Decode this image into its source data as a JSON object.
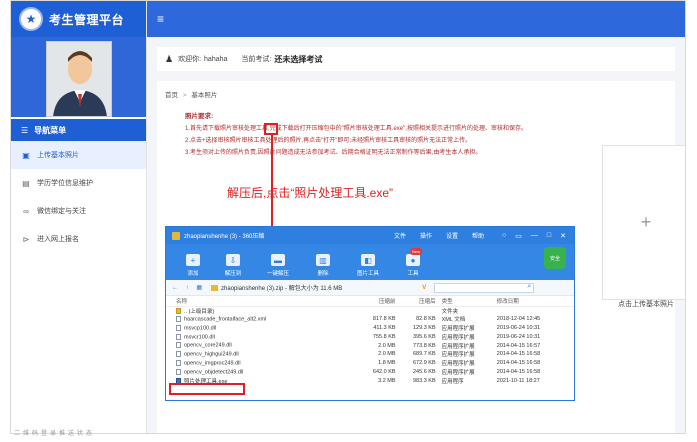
{
  "app": {
    "title": "考生管理平台",
    "menu_icon": "hamburger-icon"
  },
  "sidebar": {
    "nav_header": "导航菜单",
    "items": [
      {
        "label": "上传基本照片",
        "icon": "image-icon",
        "active": true
      },
      {
        "label": "学历学位信息维护",
        "icon": "document-icon",
        "active": false
      },
      {
        "label": "微信绑定与关注",
        "icon": "link-icon",
        "active": false
      },
      {
        "label": "进入网上报名",
        "icon": "arrow-right-icon",
        "active": false
      }
    ]
  },
  "welcome": {
    "greeting": "欢迎你:",
    "username": "hahaha",
    "exam_label": "当前考试:",
    "exam_value": "还未选择考试"
  },
  "breadcrumb": {
    "home": "首页",
    "separator": ">",
    "current": "基本照片"
  },
  "notice": {
    "title": "照片要求:",
    "lines": [
      "1.首先请下载照片审核处理工具,完成下载后打开压缩包中的\"照片审核处理工具.exe\",按照相关提示进行照片的处理、审核和保存。",
      "2.点击+选择审核照片审核工具处理后的照片,再点击\"打开\"即可;未经照片审核工具审核的照片无法正常上传。",
      "3.考生须对上传的照片负责,因照片问题造成无法参加考试、后期合格证明无法正常制作等后果,由考生本人承担。"
    ]
  },
  "annotation": "解压后,点击“照片处理工具.exe”",
  "upload": {
    "plus": "+",
    "label": "点击上传基本照片"
  },
  "zip_window": {
    "title": "zhaopianshenhe (3) - 360压缩",
    "menus": [
      "文件",
      "操作",
      "设置",
      "帮助"
    ],
    "win_buttons": [
      "○",
      "▭",
      "—",
      "□",
      "✕"
    ],
    "toolbar": [
      {
        "label": "添加",
        "icon": "plus-icon"
      },
      {
        "label": "解压到",
        "icon": "extract-icon"
      },
      {
        "label": "一键解压",
        "icon": "one-click-extract-icon"
      },
      {
        "label": "删除",
        "icon": "trash-icon"
      },
      {
        "label": "图片工具",
        "icon": "picture-icon"
      },
      {
        "label": "工具",
        "icon": "tools-icon"
      }
    ],
    "new_badge": "New",
    "safe_label": "安全",
    "address": "zhaopianshenhe (3).zip - 解包大小为 11.6 MB",
    "nav_buttons": "← ↑ ▦",
    "vmark": "V",
    "columns": [
      "名称",
      "压缩前",
      "压缩后",
      "类型",
      "修改日期"
    ],
    "rows": [
      {
        "name": ".. (上级目录)",
        "size": "",
        "comp": "",
        "type": "文件夹",
        "time": "",
        "kind": "folder"
      },
      {
        "name": "haarcascade_frontalface_alt2.xml",
        "size": "817.8 KB",
        "comp": "82.8 KB",
        "type": "XML 文档",
        "time": "2018-12-04 12:45",
        "kind": "file"
      },
      {
        "name": "msvcp100.dll",
        "size": "411.3 KB",
        "comp": "129.3 KB",
        "type": "应用程序扩展",
        "time": "2019-06-24 10:31",
        "kind": "file"
      },
      {
        "name": "msvcr100.dll",
        "size": "755.8 KB",
        "comp": "395.6 KB",
        "type": "应用程序扩展",
        "time": "2019-06-24 10:31",
        "kind": "file"
      },
      {
        "name": "opencv_core249.dll",
        "size": "2.0 MB",
        "comp": "773.8 KB",
        "type": "应用程序扩展",
        "time": "2014-04-15 16:57",
        "kind": "file"
      },
      {
        "name": "opencv_highgui249.dll",
        "size": "2.0 MB",
        "comp": "689.7 KB",
        "type": "应用程序扩展",
        "time": "2014-04-15 16:58",
        "kind": "file"
      },
      {
        "name": "opencv_imgproc249.dll",
        "size": "1.8 MB",
        "comp": "672.9 KB",
        "type": "应用程序扩展",
        "time": "2014-04-15 16:58",
        "kind": "file"
      },
      {
        "name": "opencv_objdetect249.dll",
        "size": "642.0 KB",
        "comp": "245.6 KB",
        "type": "应用程序扩展",
        "time": "2014-04-15 16:58",
        "kind": "file"
      },
      {
        "name": "照片处理工具.exe",
        "size": "3.2 MB",
        "comp": "983.3 KB",
        "type": "应用程序",
        "time": "2021-10-11 18:27",
        "kind": "exe"
      }
    ]
  },
  "bottom_note": "二维码登录推送状态"
}
